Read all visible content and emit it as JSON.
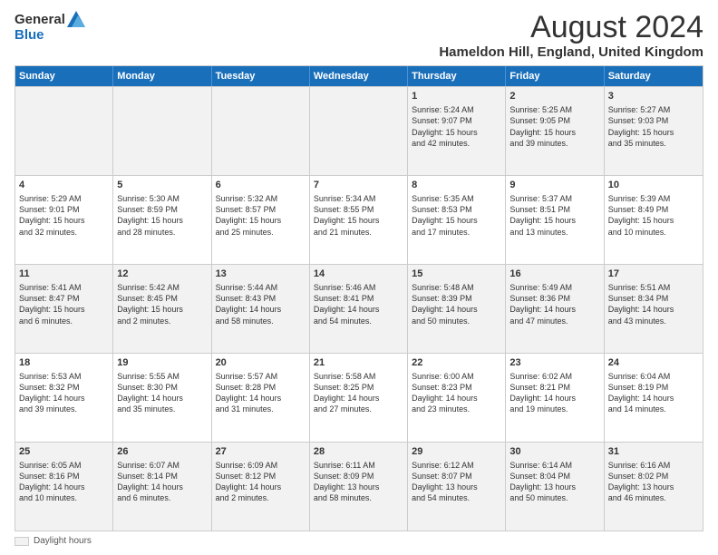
{
  "logo": {
    "general": "General",
    "blue": "Blue"
  },
  "title": "August 2024",
  "subtitle": "Hameldon Hill, England, United Kingdom",
  "headers": [
    "Sunday",
    "Monday",
    "Tuesday",
    "Wednesday",
    "Thursday",
    "Friday",
    "Saturday"
  ],
  "footer": {
    "daylight_label": "Daylight hours"
  },
  "rows": [
    [
      {
        "day": "",
        "info": ""
      },
      {
        "day": "",
        "info": ""
      },
      {
        "day": "",
        "info": ""
      },
      {
        "day": "",
        "info": ""
      },
      {
        "day": "1",
        "info": "Sunrise: 5:24 AM\nSunset: 9:07 PM\nDaylight: 15 hours\nand 42 minutes."
      },
      {
        "day": "2",
        "info": "Sunrise: 5:25 AM\nSunset: 9:05 PM\nDaylight: 15 hours\nand 39 minutes."
      },
      {
        "day": "3",
        "info": "Sunrise: 5:27 AM\nSunset: 9:03 PM\nDaylight: 15 hours\nand 35 minutes."
      }
    ],
    [
      {
        "day": "4",
        "info": "Sunrise: 5:29 AM\nSunset: 9:01 PM\nDaylight: 15 hours\nand 32 minutes."
      },
      {
        "day": "5",
        "info": "Sunrise: 5:30 AM\nSunset: 8:59 PM\nDaylight: 15 hours\nand 28 minutes."
      },
      {
        "day": "6",
        "info": "Sunrise: 5:32 AM\nSunset: 8:57 PM\nDaylight: 15 hours\nand 25 minutes."
      },
      {
        "day": "7",
        "info": "Sunrise: 5:34 AM\nSunset: 8:55 PM\nDaylight: 15 hours\nand 21 minutes."
      },
      {
        "day": "8",
        "info": "Sunrise: 5:35 AM\nSunset: 8:53 PM\nDaylight: 15 hours\nand 17 minutes."
      },
      {
        "day": "9",
        "info": "Sunrise: 5:37 AM\nSunset: 8:51 PM\nDaylight: 15 hours\nand 13 minutes."
      },
      {
        "day": "10",
        "info": "Sunrise: 5:39 AM\nSunset: 8:49 PM\nDaylight: 15 hours\nand 10 minutes."
      }
    ],
    [
      {
        "day": "11",
        "info": "Sunrise: 5:41 AM\nSunset: 8:47 PM\nDaylight: 15 hours\nand 6 minutes."
      },
      {
        "day": "12",
        "info": "Sunrise: 5:42 AM\nSunset: 8:45 PM\nDaylight: 15 hours\nand 2 minutes."
      },
      {
        "day": "13",
        "info": "Sunrise: 5:44 AM\nSunset: 8:43 PM\nDaylight: 14 hours\nand 58 minutes."
      },
      {
        "day": "14",
        "info": "Sunrise: 5:46 AM\nSunset: 8:41 PM\nDaylight: 14 hours\nand 54 minutes."
      },
      {
        "day": "15",
        "info": "Sunrise: 5:48 AM\nSunset: 8:39 PM\nDaylight: 14 hours\nand 50 minutes."
      },
      {
        "day": "16",
        "info": "Sunrise: 5:49 AM\nSunset: 8:36 PM\nDaylight: 14 hours\nand 47 minutes."
      },
      {
        "day": "17",
        "info": "Sunrise: 5:51 AM\nSunset: 8:34 PM\nDaylight: 14 hours\nand 43 minutes."
      }
    ],
    [
      {
        "day": "18",
        "info": "Sunrise: 5:53 AM\nSunset: 8:32 PM\nDaylight: 14 hours\nand 39 minutes."
      },
      {
        "day": "19",
        "info": "Sunrise: 5:55 AM\nSunset: 8:30 PM\nDaylight: 14 hours\nand 35 minutes."
      },
      {
        "day": "20",
        "info": "Sunrise: 5:57 AM\nSunset: 8:28 PM\nDaylight: 14 hours\nand 31 minutes."
      },
      {
        "day": "21",
        "info": "Sunrise: 5:58 AM\nSunset: 8:25 PM\nDaylight: 14 hours\nand 27 minutes."
      },
      {
        "day": "22",
        "info": "Sunrise: 6:00 AM\nSunset: 8:23 PM\nDaylight: 14 hours\nand 23 minutes."
      },
      {
        "day": "23",
        "info": "Sunrise: 6:02 AM\nSunset: 8:21 PM\nDaylight: 14 hours\nand 19 minutes."
      },
      {
        "day": "24",
        "info": "Sunrise: 6:04 AM\nSunset: 8:19 PM\nDaylight: 14 hours\nand 14 minutes."
      }
    ],
    [
      {
        "day": "25",
        "info": "Sunrise: 6:05 AM\nSunset: 8:16 PM\nDaylight: 14 hours\nand 10 minutes."
      },
      {
        "day": "26",
        "info": "Sunrise: 6:07 AM\nSunset: 8:14 PM\nDaylight: 14 hours\nand 6 minutes."
      },
      {
        "day": "27",
        "info": "Sunrise: 6:09 AM\nSunset: 8:12 PM\nDaylight: 14 hours\nand 2 minutes."
      },
      {
        "day": "28",
        "info": "Sunrise: 6:11 AM\nSunset: 8:09 PM\nDaylight: 13 hours\nand 58 minutes."
      },
      {
        "day": "29",
        "info": "Sunrise: 6:12 AM\nSunset: 8:07 PM\nDaylight: 13 hours\nand 54 minutes."
      },
      {
        "day": "30",
        "info": "Sunrise: 6:14 AM\nSunset: 8:04 PM\nDaylight: 13 hours\nand 50 minutes."
      },
      {
        "day": "31",
        "info": "Sunrise: 6:16 AM\nSunset: 8:02 PM\nDaylight: 13 hours\nand 46 minutes."
      }
    ]
  ]
}
